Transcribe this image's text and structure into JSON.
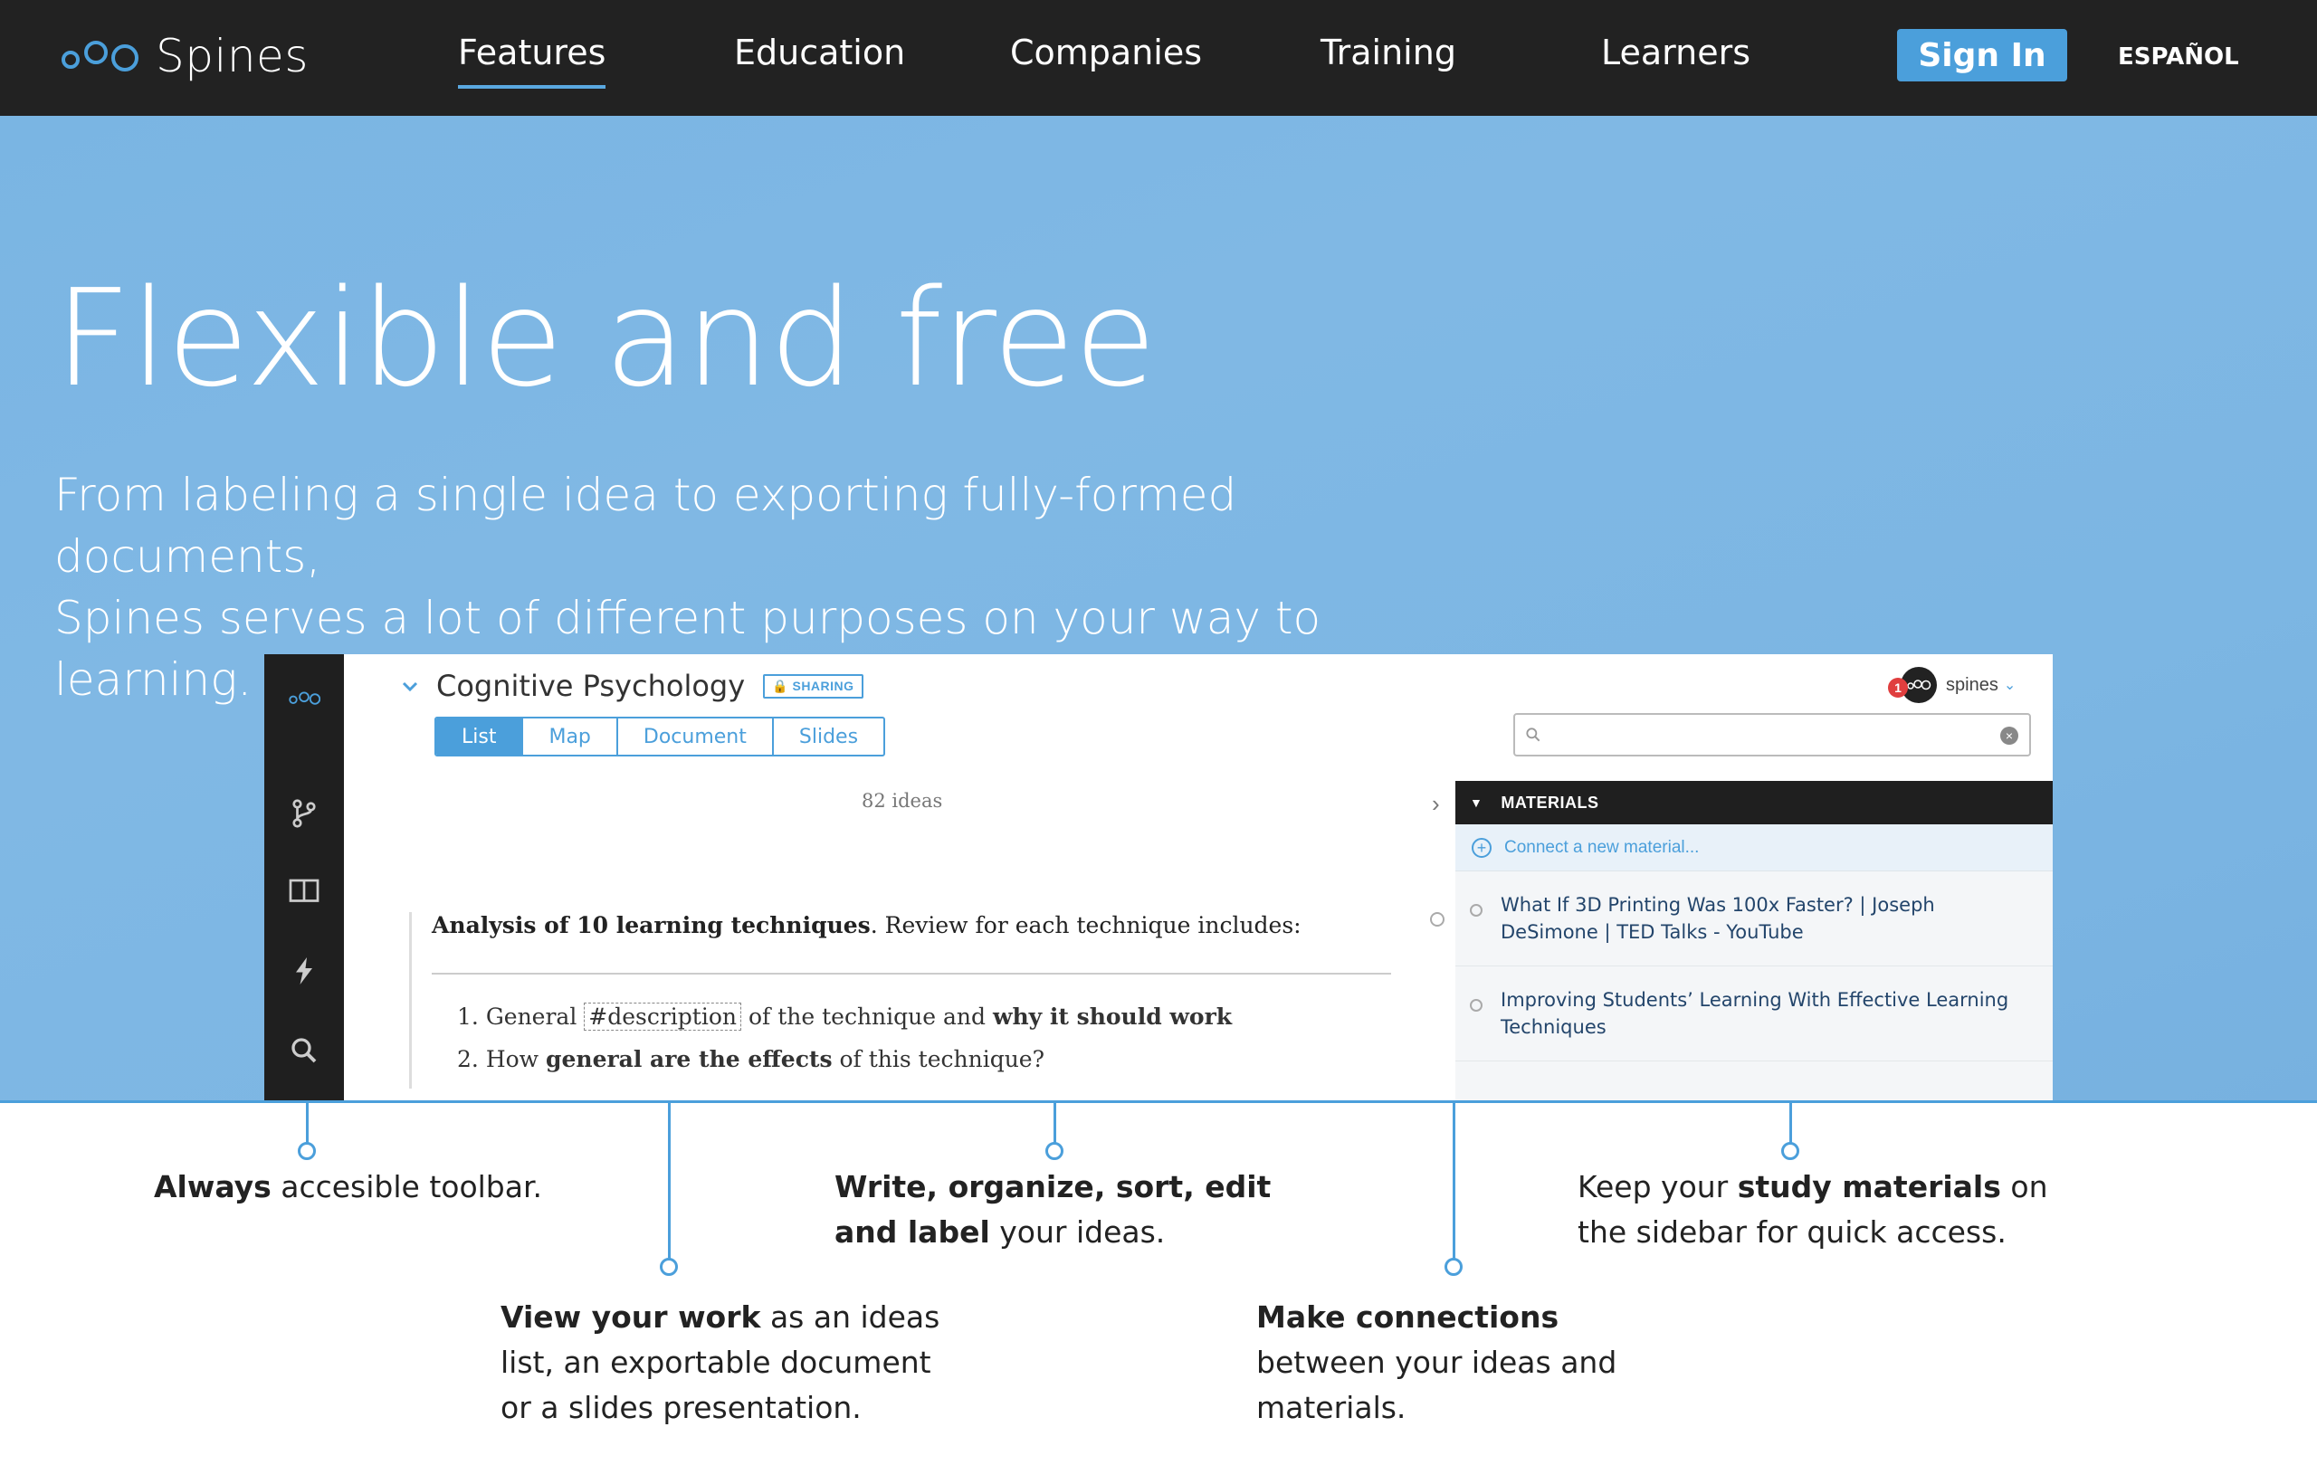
{
  "nav": {
    "brand": "Spines",
    "links": [
      "Features",
      "Education",
      "Companies",
      "Training",
      "Learners"
    ],
    "active": "Features",
    "signin_label": "Sign In",
    "language_label": "ESPAÑOL"
  },
  "hero": {
    "title": "Flexible and free",
    "subtitle_line1": "From labeling a single idea to exporting fully-formed documents,",
    "subtitle_line2": "Spines serves a lot of different purposes on your way to learning."
  },
  "app": {
    "doc_title": "Cognitive Psychology",
    "sharing_badge": "SHARING",
    "view_tabs": [
      "List",
      "Map",
      "Document",
      "Slides"
    ],
    "active_view": "List",
    "user": {
      "name": "spines",
      "notification_count": "1"
    },
    "search": {
      "value": "",
      "placeholder": ""
    },
    "ideas_count": "82 ideas",
    "note": {
      "bold_intro": "Analysis of 10 learning techniques",
      "rest_intro": ". Review for each technique includes:",
      "items": [
        {
          "num": "1.",
          "pre": "General ",
          "tag": "#description",
          "mid": " of the technique and ",
          "bold": "why it should work",
          "post": ""
        },
        {
          "num": "2.",
          "pre": "How ",
          "tag": "",
          "mid": "",
          "bold": "general are the effects",
          "post": " of this technique?"
        }
      ]
    },
    "materials": {
      "header": "MATERIALS",
      "connect_label": "Connect a new material...",
      "items": [
        "What If 3D Printing Was 100x Faster? | Joseph DeSimone | TED Talks - YouTube",
        "Improving Students’ Learning With Effective Learning Techniques"
      ]
    }
  },
  "callouts": [
    {
      "bold": "Always",
      "rest": " accesible toolbar."
    },
    {
      "bold": "View your work",
      "rest": " as an ideas list, an exportable document or a slides presentation."
    },
    {
      "bold": "Write, organize, sort, edit and label",
      "rest": " your ideas."
    },
    {
      "bold": "Make connections",
      "rest": " between your ideas and materials."
    },
    {
      "pre": "Keep your ",
      "bold": "study materials",
      "rest": " on the sidebar for quick access."
    }
  ],
  "colors": {
    "nav_bg": "#222222",
    "hero_bg": "#7ab5e3",
    "accent": "#4b9fdb"
  }
}
